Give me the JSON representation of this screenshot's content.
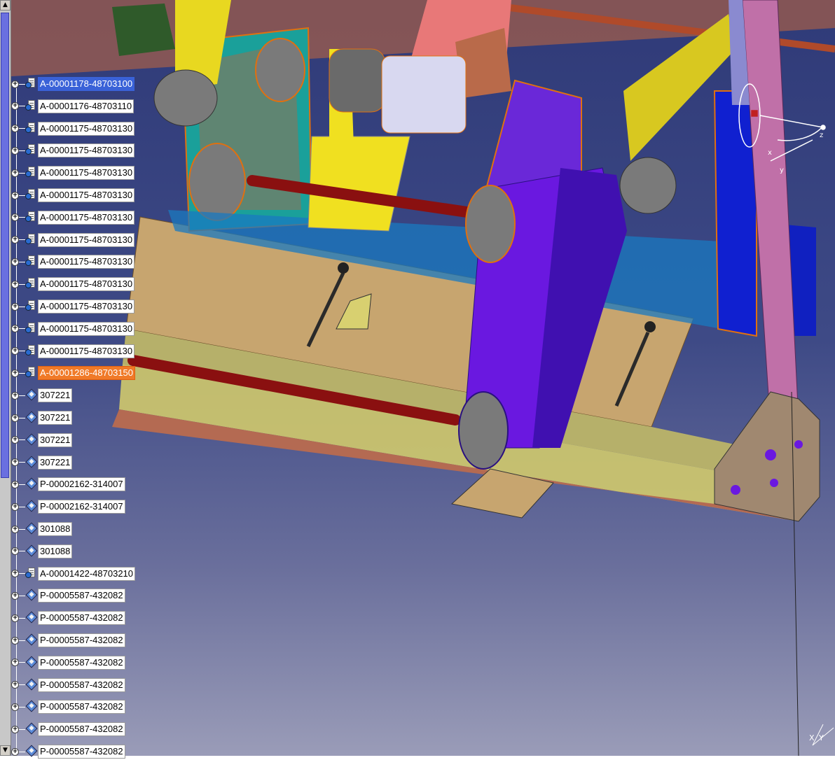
{
  "app": {
    "window_title": ""
  },
  "colors": {
    "selection": "#3a62d8",
    "highlight": "#f07a28",
    "background_top": "#2f3a78",
    "background_bottom": "#9a9cb8"
  },
  "scrollbar": {
    "up_icon": "triangle-up-icon",
    "down_icon": "triangle-down-icon"
  },
  "tree": {
    "items": [
      {
        "label": "A-00001178-48703100",
        "icon": "product-icon",
        "state": "selected"
      },
      {
        "label": "A-00001176-48703110",
        "icon": "product-icon",
        "state": ""
      },
      {
        "label": "A-00001175-48703130",
        "icon": "product-icon",
        "state": ""
      },
      {
        "label": "A-00001175-48703130",
        "icon": "product-icon",
        "state": ""
      },
      {
        "label": "A-00001175-48703130",
        "icon": "product-icon",
        "state": ""
      },
      {
        "label": "A-00001175-48703130",
        "icon": "product-icon",
        "state": ""
      },
      {
        "label": "A-00001175-48703130",
        "icon": "product-icon",
        "state": ""
      },
      {
        "label": "A-00001175-48703130",
        "icon": "product-icon",
        "state": ""
      },
      {
        "label": "A-00001175-48703130",
        "icon": "product-icon",
        "state": ""
      },
      {
        "label": "A-00001175-48703130",
        "icon": "product-icon",
        "state": ""
      },
      {
        "label": "A-00001175-48703130",
        "icon": "product-icon",
        "state": ""
      },
      {
        "label": "A-00001175-48703130",
        "icon": "product-icon",
        "state": ""
      },
      {
        "label": "A-00001175-48703130",
        "icon": "product-icon",
        "state": ""
      },
      {
        "label": "A-00001286-48703150",
        "icon": "product-icon",
        "state": "highlighted"
      },
      {
        "label": "307221",
        "icon": "part-icon",
        "state": ""
      },
      {
        "label": "307221",
        "icon": "part-icon",
        "state": ""
      },
      {
        "label": "307221",
        "icon": "part-icon",
        "state": ""
      },
      {
        "label": "307221",
        "icon": "part-icon",
        "state": ""
      },
      {
        "label": "P-00002162-314007",
        "icon": "part-icon",
        "state": ""
      },
      {
        "label": "P-00002162-314007",
        "icon": "part-icon",
        "state": ""
      },
      {
        "label": "301088",
        "icon": "part-icon",
        "state": ""
      },
      {
        "label": "301088",
        "icon": "part-icon",
        "state": ""
      },
      {
        "label": "A-00001422-48703210",
        "icon": "product-icon",
        "state": ""
      },
      {
        "label": "P-00005587-432082",
        "icon": "part-icon",
        "state": ""
      },
      {
        "label": "P-00005587-432082",
        "icon": "part-icon",
        "state": ""
      },
      {
        "label": "P-00005587-432082",
        "icon": "part-icon",
        "state": ""
      },
      {
        "label": "P-00005587-432082",
        "icon": "part-icon",
        "state": ""
      },
      {
        "label": "P-00005587-432082",
        "icon": "part-icon",
        "state": ""
      },
      {
        "label": "P-00005587-432082",
        "icon": "part-icon",
        "state": ""
      },
      {
        "label": "P-00005587-432082",
        "icon": "part-icon",
        "state": ""
      },
      {
        "label": "P-00005587-432082",
        "icon": "part-icon",
        "state": ""
      }
    ]
  },
  "compass": {
    "axes": [
      "x",
      "y",
      "z"
    ]
  },
  "corner_axis": {
    "x_label": "X",
    "y_label": "Y"
  }
}
